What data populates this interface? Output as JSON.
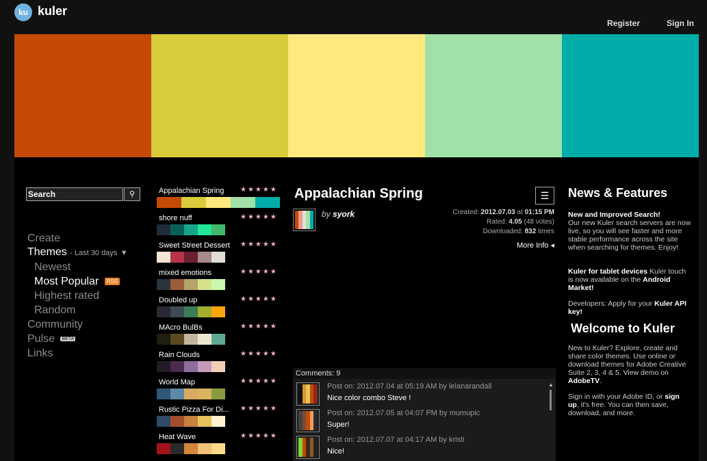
{
  "header": {
    "logo_badge": "ku",
    "logo_text": "kuler",
    "register_label": "Register",
    "signin_label": "Sign In"
  },
  "hero_colors": [
    "#c44a05",
    "#d9cc3a",
    "#ffe87d",
    "#a1e1a8",
    "#00ada8"
  ],
  "search": {
    "value": "Search",
    "button_icon": "search-icon"
  },
  "nav": {
    "create": "Create",
    "themes": "Themes",
    "themes_period": "- Last 30 days",
    "dropdown_icon": "▼",
    "newest": "Newest",
    "most_popular": "Most Popular",
    "rss": "RSS",
    "highest_rated": "Highest rated",
    "random": "Random",
    "community": "Community",
    "pulse": "Pulse",
    "beta": "BETA",
    "links": "Links"
  },
  "themes": [
    {
      "name": "Appalachian Spring",
      "stars": "★★★★★",
      "colors": [
        "#c44a05",
        "#d9cc3a",
        "#ffe87d",
        "#a1e1a8",
        "#00ada8"
      ]
    },
    {
      "name": "shore nuff",
      "stars": "★★★★★",
      "colors": [
        "#1f2c3a",
        "#0b5f59",
        "#14a58a",
        "#22e69a",
        "#3fb86d"
      ]
    },
    {
      "name": "Sweet Street Dessert",
      "stars": "★★★★★",
      "colors": [
        "#f5e7d4",
        "#b6344a",
        "#6b2033",
        "#a68b88",
        "#e2ddd7"
      ]
    },
    {
      "name": "mixed emotions",
      "stars": "★★★★★",
      "colors": [
        "#2d333c",
        "#9b5c3a",
        "#b4a36a",
        "#d7e08a",
        "#c9f7ae"
      ]
    },
    {
      "name": "Doubled up",
      "stars": "★★★★★",
      "colors": [
        "#2a2a33",
        "#3f4a55",
        "#3b7d55",
        "#a3ae2f",
        "#ffa40b"
      ]
    },
    {
      "name": "MAcro BulBs",
      "stars": "★★★★★",
      "colors": [
        "#201d12",
        "#5a4a20",
        "#c2b69c",
        "#ece6cf",
        "#5ea990"
      ]
    },
    {
      "name": "Rain Clouds",
      "stars": "★★★★★",
      "colors": [
        "#231b26",
        "#4a2a4d",
        "#8c6f9c",
        "#c69ab8",
        "#f2d0b8"
      ]
    },
    {
      "name": "World Map",
      "stars": "★★★★★",
      "colors": [
        "#2f5677",
        "#5e89a4",
        "#d7aa61",
        "#d8b45f",
        "#8a9a3f"
      ]
    },
    {
      "name": "Rustic Pizza For Di...",
      "stars": "★★★★★",
      "colors": [
        "#2e4a66",
        "#a44f2b",
        "#c8813f",
        "#e8c05c",
        "#fff3cf"
      ]
    },
    {
      "name": "Heat Wave",
      "stars": "★★★★★",
      "colors": [
        "#a2121a",
        "#2a2a2a",
        "#d3853c",
        "#f2c178",
        "#ffd98a"
      ]
    }
  ],
  "detail": {
    "title": "Appalachian Spring",
    "by_label": "by",
    "author": "syork",
    "thumb_colors": [
      "#c44a05",
      "#f59a8c",
      "#e4e0d8",
      "#a1e1a8",
      "#00ada8"
    ],
    "created_label": "Created:",
    "created_date": "2012.07.03",
    "created_at": "at",
    "created_time": "01:15 PM",
    "rated_label": "Rated:",
    "rated_value": "4.05",
    "rated_votes": "(48 votes)",
    "downloaded_label": "Downloaded:",
    "downloaded_value": "832",
    "downloaded_suffix": "times",
    "more_info": "More Info ◂",
    "settings_icon": "sliders-icon"
  },
  "comments": {
    "header": "Comments: 9",
    "items": [
      {
        "meta": "Post on: 2012.07.04 at 05:19 AM by lelanarandall",
        "text": "Nice color combo Steve !",
        "colors": [
          "#111",
          "#d59a2c",
          "#e8c05c",
          "#c44a05",
          "#8a2a1c"
        ]
      },
      {
        "meta": "Post on: 2012.07.05 at 04:07 PM by mumupic",
        "text": "Super!",
        "colors": [
          "#444",
          "#7a4a3a",
          "#c44a05",
          "#e8a05c",
          "#2a2a2a"
        ]
      },
      {
        "meta": "Post on: 2012.07.07 at 04:17 AM by kristi",
        "text": "Nice!",
        "colors": [
          "#7dd33a",
          "#c44a05",
          "#3a2a1a",
          "#8b5a2b",
          "#222"
        ]
      }
    ]
  },
  "news": {
    "title": "News & Features",
    "item1_title": "New and Improved Search!",
    "item1_body": "Our new Kuler search servers are now live, so you will see faster and more stable performance across the site when searching for themes.  Enjoy!",
    "item2_title": "Kuler for tablet devices",
    "item2_body": " Kuler touch is now available on the ",
    "item2_link": "Android Market!",
    "item3_pre": "Developers: Apply for your ",
    "item3_link": "Kuler API key!",
    "welcome_title": "Welcome to Kuler",
    "welcome_body": "New to Kuler? Explore, create and share color themes. Use online or download themes for Adobe Creative Suite 2, 3, 4 & 5. View demo on ",
    "welcome_link": "AdobeTV",
    "welcome_end": ".",
    "signin_pre": "Sign in with your Adobe ID, or ",
    "signin_link": "sign up",
    "signin_post": ", it's free. You can then save, download, and more."
  }
}
